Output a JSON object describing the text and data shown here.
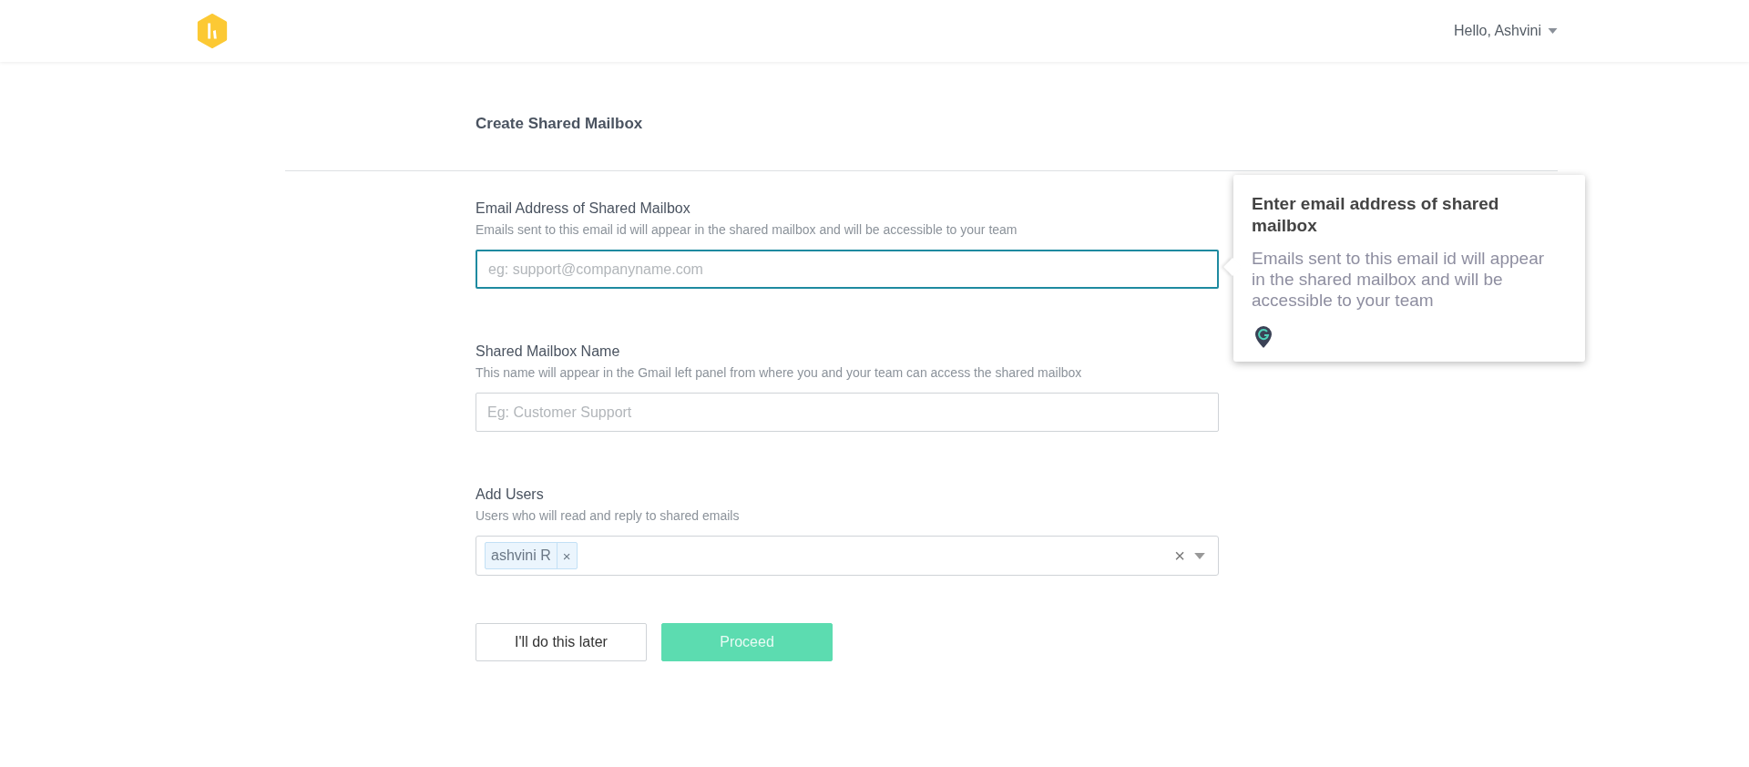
{
  "header": {
    "greeting": "Hello, Ashvini"
  },
  "page_title": "Create Shared Mailbox",
  "fields": [
    {
      "label": "Email Address of Shared Mailbox",
      "description": "Emails sent to this email id will appear in the shared mailbox and will be accessible to your team",
      "placeholder": "eg: support@companyname.com",
      "focused": true
    },
    {
      "label": "Shared Mailbox Name",
      "description": "This name will appear in the Gmail left panel from where you and your team can access the shared mailbox",
      "placeholder": "Eg: Customer Support",
      "focused": false
    }
  ],
  "users": {
    "label": "Add Users",
    "description": "Users who will read and reply to shared emails",
    "tags": [
      {
        "label": "ashvini R",
        "remove": "×"
      }
    ],
    "clear": "×"
  },
  "tooltip": {
    "title": "Enter email address of shared mailbox",
    "body": "Emails sent to this email id will appear in the shared mailbox and will be accessible to your team"
  },
  "buttons": [
    {
      "label": "I'll do this later",
      "kind": "secondary",
      "disabled": false
    },
    {
      "label": "Proceed",
      "kind": "primary",
      "disabled": true
    }
  ]
}
